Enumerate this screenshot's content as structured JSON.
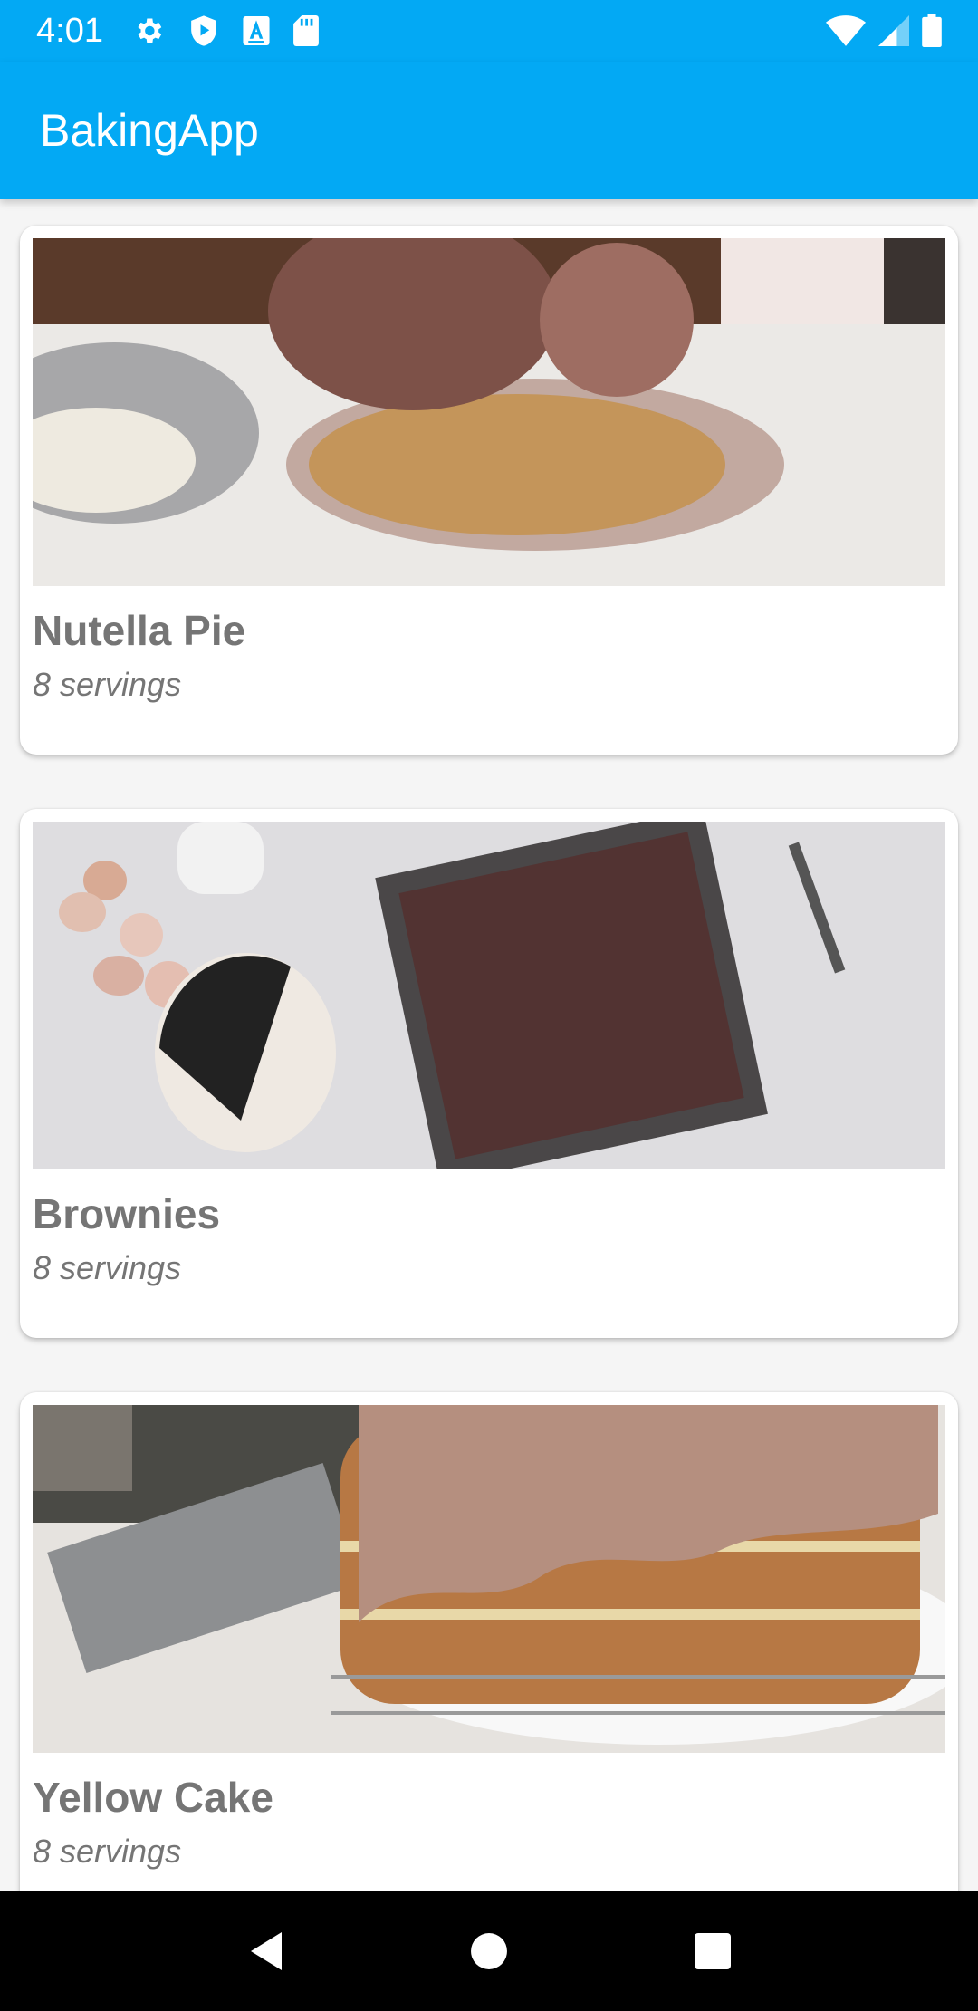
{
  "status_bar": {
    "time": "4:01",
    "left_icons": [
      "gear-icon",
      "shield-play-icon",
      "font-a-icon",
      "sd-card-icon"
    ],
    "right_icons": [
      "wifi-icon",
      "cell-signal-icon",
      "battery-icon"
    ]
  },
  "app_bar": {
    "title": "BakingApp",
    "color": "#03a9f4"
  },
  "recipes": [
    {
      "name": "Nutella Pie",
      "servings": "8 servings",
      "image": "nutella-pie-photo"
    },
    {
      "name": "Brownies",
      "servings": "8 servings",
      "image": "brownies-photo"
    },
    {
      "name": "Yellow Cake",
      "servings": "8 servings",
      "image": "yellow-cake-photo"
    }
  ],
  "nav_bar": {
    "buttons": [
      "back-icon",
      "home-icon",
      "recents-icon"
    ]
  }
}
